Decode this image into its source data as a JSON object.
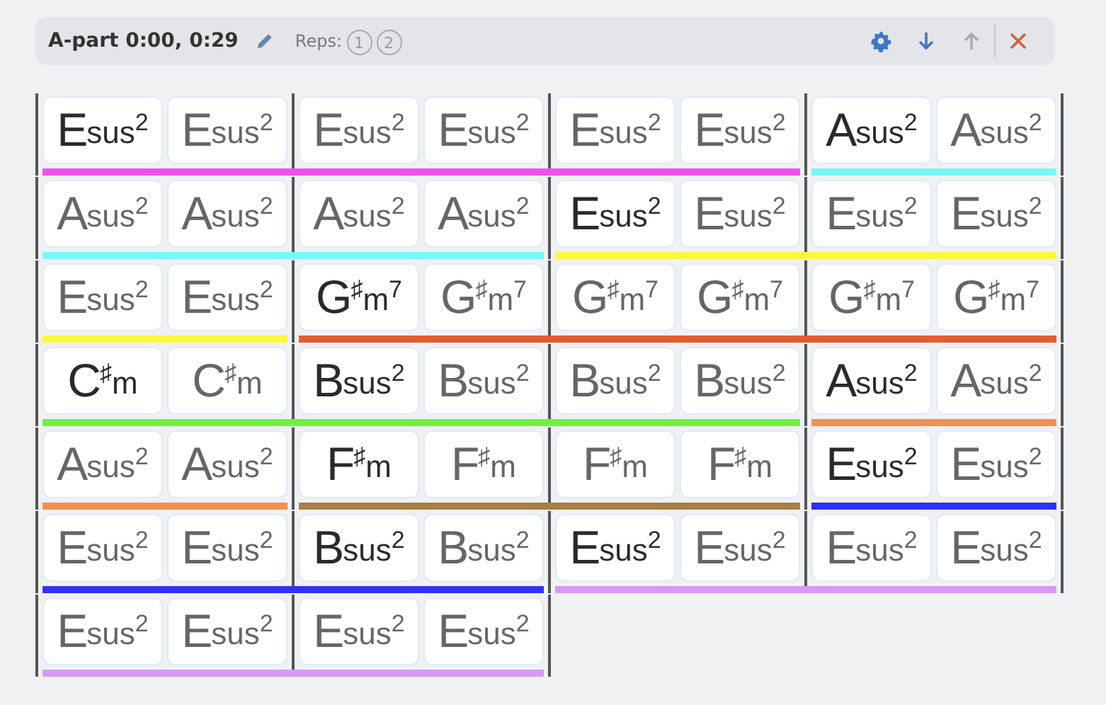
{
  "header": {
    "title": "A-part 0:00, 0:29",
    "reps_label": "Reps:",
    "reps": [
      "1",
      "2"
    ],
    "actions": [
      {
        "kind": "settings",
        "disabled": false
      },
      {
        "kind": "down",
        "disabled": false
      },
      {
        "kind": "up",
        "disabled": true
      },
      {
        "kind": "close",
        "disabled": false
      }
    ]
  },
  "rows": [
    {
      "cells": [
        {
          "root": "E",
          "quality": "sus$^{2}$",
          "start": true,
          "color": "#f050f0"
        },
        {
          "root": "E",
          "quality": "sus$^{2}$",
          "start": false,
          "color": "#f050f0"
        },
        {
          "root": "E",
          "quality": "sus$^{2}$",
          "start": false,
          "color": "#f050f0"
        },
        {
          "root": "E",
          "quality": "sus$^{2}$",
          "start": false,
          "color": "#f050f0"
        },
        {
          "root": "E",
          "quality": "sus$^{2}$",
          "start": false,
          "color": "#f050f0"
        },
        {
          "root": "E",
          "quality": "sus$^{2}$",
          "start": false,
          "color": "#f050f0"
        },
        {
          "root": "A",
          "quality": "sus$^{2}$",
          "start": true,
          "color": "#78f8f8"
        },
        {
          "root": "A",
          "quality": "sus$^{2}$",
          "start": false,
          "color": "#78f8f8"
        }
      ]
    },
    {
      "cells": [
        {
          "root": "A",
          "quality": "sus$^{2}$",
          "start": false,
          "color": "#78f8f8"
        },
        {
          "root": "A",
          "quality": "sus$^{2}$",
          "start": false,
          "color": "#78f8f8"
        },
        {
          "root": "A",
          "quality": "sus$^{2}$",
          "start": false,
          "color": "#78f8f8"
        },
        {
          "root": "A",
          "quality": "sus$^{2}$",
          "start": false,
          "color": "#78f8f8"
        },
        {
          "root": "E",
          "quality": "sus$^{2}$",
          "start": true,
          "color": "#f8f840"
        },
        {
          "root": "E",
          "quality": "sus$^{2}$",
          "start": false,
          "color": "#f8f840"
        },
        {
          "root": "E",
          "quality": "sus$^{2}$",
          "start": false,
          "color": "#f8f840"
        },
        {
          "root": "E",
          "quality": "sus$^{2}$",
          "start": false,
          "color": "#f8f840"
        }
      ]
    },
    {
      "cells": [
        {
          "root": "E",
          "quality": "sus$^{2}$",
          "start": false,
          "color": "#f8f840"
        },
        {
          "root": "E",
          "quality": "sus$^{2}$",
          "start": false,
          "color": "#f8f840"
        },
        {
          "root": "G",
          "quality": "$^{♯}$m$^{7}$",
          "start": true,
          "color": "#e85a30"
        },
        {
          "root": "G",
          "quality": "$^{♯}$m$^{7}$",
          "start": false,
          "color": "#e85a30"
        },
        {
          "root": "G",
          "quality": "$^{♯}$m$^{7}$",
          "start": false,
          "color": "#e85a30"
        },
        {
          "root": "G",
          "quality": "$^{♯}$m$^{7}$",
          "start": false,
          "color": "#e85a30"
        },
        {
          "root": "G",
          "quality": "$^{♯}$m$^{7}$",
          "start": false,
          "color": "#e85a30"
        },
        {
          "root": "G",
          "quality": "$^{♯}$m$^{7}$",
          "start": false,
          "color": "#e85a30"
        }
      ]
    },
    {
      "cells": [
        {
          "root": "C",
          "quality": "$^{♯}$m",
          "start": true,
          "color": "#70f040"
        },
        {
          "root": "C",
          "quality": "$^{♯}$m",
          "start": false,
          "color": "#70f040"
        },
        {
          "root": "B",
          "quality": "sus$^{2}$",
          "start": true,
          "color": "#70f040"
        },
        {
          "root": "B",
          "quality": "sus$^{2}$",
          "start": false,
          "color": "#70f040"
        },
        {
          "root": "B",
          "quality": "sus$^{2}$",
          "start": false,
          "color": "#70f040"
        },
        {
          "root": "B",
          "quality": "sus$^{2}$",
          "start": false,
          "color": "#70f040"
        },
        {
          "root": "A",
          "quality": "sus$^{2}$",
          "start": true,
          "color": "#f09050"
        },
        {
          "root": "A",
          "quality": "sus$^{2}$",
          "start": false,
          "color": "#f09050"
        }
      ]
    },
    {
      "cells": [
        {
          "root": "A",
          "quality": "sus$^{2}$",
          "start": false,
          "color": "#f09050"
        },
        {
          "root": "A",
          "quality": "sus$^{2}$",
          "start": false,
          "color": "#f09050"
        },
        {
          "root": "F",
          "quality": "$^{♯}$m",
          "start": true,
          "color": "#a88048"
        },
        {
          "root": "F",
          "quality": "$^{♯}$m",
          "start": false,
          "color": "#a88048"
        },
        {
          "root": "F",
          "quality": "$^{♯}$m",
          "start": false,
          "color": "#a88048"
        },
        {
          "root": "F",
          "quality": "$^{♯}$m",
          "start": false,
          "color": "#a88048"
        },
        {
          "root": "E",
          "quality": "sus$^{2}$",
          "start": true,
          "color": "#3030f8"
        },
        {
          "root": "E",
          "quality": "sus$^{2}$",
          "start": false,
          "color": "#3030f8"
        }
      ]
    },
    {
      "cells": [
        {
          "root": "E",
          "quality": "sus$^{2}$",
          "start": false,
          "color": "#3030f8"
        },
        {
          "root": "E",
          "quality": "sus$^{2}$",
          "start": false,
          "color": "#3030f8"
        },
        {
          "root": "B",
          "quality": "sus$^{2}$",
          "start": true,
          "color": "#3030f8"
        },
        {
          "root": "B",
          "quality": "sus$^{2}$",
          "start": false,
          "color": "#3030f8"
        },
        {
          "root": "E",
          "quality": "sus$^{2}$",
          "start": true,
          "color": "#d898f8"
        },
        {
          "root": "E",
          "quality": "sus$^{2}$",
          "start": false,
          "color": "#d898f8"
        },
        {
          "root": "E",
          "quality": "sus$^{2}$",
          "start": false,
          "color": "#d898f8"
        },
        {
          "root": "E",
          "quality": "sus$^{2}$",
          "start": false,
          "color": "#d898f8"
        }
      ]
    },
    {
      "cells": [
        {
          "root": "E",
          "quality": "sus$^{2}$",
          "start": false,
          "color": "#d898f8"
        },
        {
          "root": "E",
          "quality": "sus$^{2}$",
          "start": false,
          "color": "#d898f8"
        },
        {
          "root": "E",
          "quality": "sus$^{2}$",
          "start": false,
          "color": "#d898f8"
        },
        {
          "root": "E",
          "quality": "sus$^{2}$",
          "start": false,
          "color": "#d898f8"
        }
      ]
    }
  ]
}
